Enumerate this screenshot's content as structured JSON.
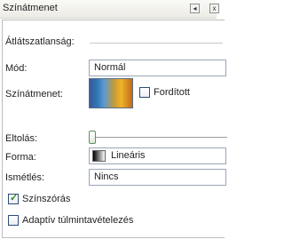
{
  "panel": {
    "title": "Színátmenet"
  },
  "options": {
    "opacity_label": "Átlátszatlanság:",
    "mode_label": "Mód:",
    "mode_value": "Normál",
    "gradient_label": "Színátmenet:",
    "reverse_label": "Fordított",
    "reverse_checked": false,
    "offset_label": "Eltolás:",
    "shape_label": "Forma:",
    "shape_value": "Lineáris",
    "repeat_label": "Ismétlés:",
    "repeat_value": "Nincs",
    "dither_label": "Színszórás",
    "dither_checked": true,
    "adaptive_label": "Adaptív túlmintavételezés",
    "adaptive_checked": false
  },
  "colors": {
    "gradient_stops": [
      "#3a5a9a",
      "#2f77b5",
      "#5c9ad0",
      "#c69a35",
      "#f0b42a",
      "#c26a1a"
    ],
    "check_color": "#2a8a2a"
  },
  "icons": {
    "restore": "restore-icon",
    "close": "close-icon",
    "shape": "linear-gradient-icon"
  }
}
